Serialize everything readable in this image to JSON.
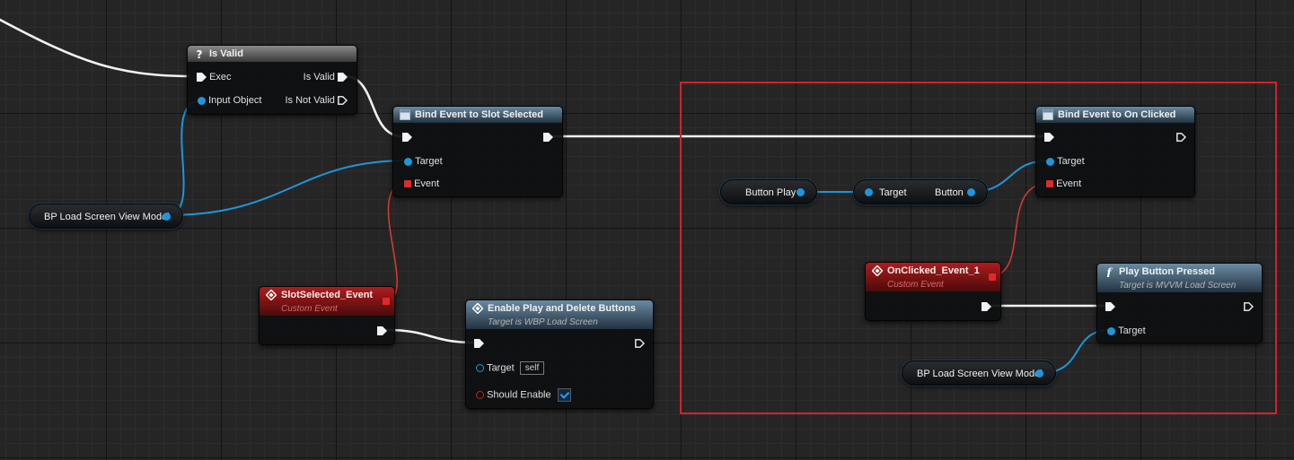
{
  "colors": {
    "exec": "#f2f2f2",
    "object": "#1d96dc",
    "delegate": "#d23a30",
    "selection": "#d2232a"
  },
  "nodes": {
    "is_valid": {
      "title": "Is Valid",
      "icon": "question-mark-icon",
      "exec_in": "Exec",
      "input_object": "Input Object",
      "is_valid": "Is Valid",
      "is_not_valid": "Is Not Valid"
    },
    "bind_slot_selected": {
      "title": "Bind Event to Slot Selected",
      "icon": "function-box-icon",
      "target": "Target",
      "event": "Event"
    },
    "bp_view_model_left": {
      "label": "BP Load Screen View Model"
    },
    "slot_selected_event": {
      "title": "SlotSelected_Event",
      "subtitle": "Custom Event",
      "icon": "event-diamond-icon"
    },
    "enable_buttons": {
      "title": "Enable Play and Delete Buttons",
      "subtitle": "Target is WBP Load Screen",
      "icon": "function-diamond-icon",
      "target": "Target",
      "target_default": "self",
      "should_enable": "Should Enable",
      "should_enable_value": true
    },
    "button_play_var": {
      "label": "Button Play"
    },
    "get_button": {
      "target": "Target",
      "output": "Button"
    },
    "bind_on_clicked": {
      "title": "Bind Event to On Clicked",
      "icon": "function-box-icon",
      "target": "Target",
      "event": "Event"
    },
    "onclicked_event": {
      "title": "OnClicked_Event_1",
      "subtitle": "Custom Event",
      "icon": "event-diamond-icon"
    },
    "play_button_pressed": {
      "title": "Play Button Pressed",
      "subtitle": "Target is MVVM Load Screen",
      "icon": "function-f-icon",
      "target": "Target"
    },
    "bp_view_model_right": {
      "label": "BP Load Screen View Model"
    }
  }
}
